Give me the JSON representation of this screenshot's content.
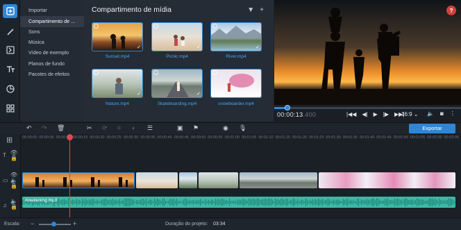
{
  "rail": {
    "icons": [
      "import-icon",
      "magic-wand-icon",
      "transitions-icon",
      "titles-icon",
      "stickers-icon",
      "more-tools-icon"
    ]
  },
  "categories": {
    "items": [
      "Importar",
      "Compartimento de ...",
      "Sons",
      "Música",
      "Vídeo de exemplo",
      "Planos de fundo",
      "Pacotes de efeitos"
    ],
    "active_index": 1
  },
  "media": {
    "title": "Compartimento de mídia",
    "filter_icon": "filter-icon",
    "add_icon": "plus-icon",
    "files": [
      {
        "name": "Sunset.mp4",
        "checked": true
      },
      {
        "name": "Picnic.mp4",
        "checked": true
      },
      {
        "name": "River.mp4",
        "checked": true
      },
      {
        "name": "Nature.mp4",
        "checked": true
      },
      {
        "name": "Skateboarding.mp4",
        "checked": true
      },
      {
        "name": "snowboarder.mp4",
        "checked": true
      }
    ]
  },
  "preview": {
    "help_label": "?",
    "time_current": "00:00:13",
    "time_ms": ".400",
    "aspect_ratio": "16:9",
    "playback_progress": 0.07
  },
  "toolbar": {
    "export_label": "Exportar"
  },
  "ruler": {
    "labels": [
      "00:00:00",
      "00:00:05",
      "00:00:10",
      "00:00:15",
      "00:00:20",
      "00:00:25",
      "00:00:30",
      "00:00:35",
      "00:00:40",
      "00:00:45",
      "00:00:50",
      "00:00:55",
      "00:01:00",
      "00:01:05",
      "00:01:10",
      "00:01:15",
      "00:01:20",
      "00:01:25",
      "00:01:30",
      "00:01:35",
      "00:01:40",
      "00:01:45",
      "00:01:50",
      "00:01:55",
      "00:02:00",
      "00:02:05"
    ]
  },
  "audio_track": {
    "label": "Awakening.mp3"
  },
  "status": {
    "scale_label": "Escala:",
    "duration_label": "Duração do projeto:",
    "duration_value": "03:34",
    "zoom_level": 0.45
  },
  "colors": {
    "accent": "#2f86d6",
    "playhead": "#e8434e",
    "audio": "#3bb9a8",
    "help": "#d2403a"
  }
}
